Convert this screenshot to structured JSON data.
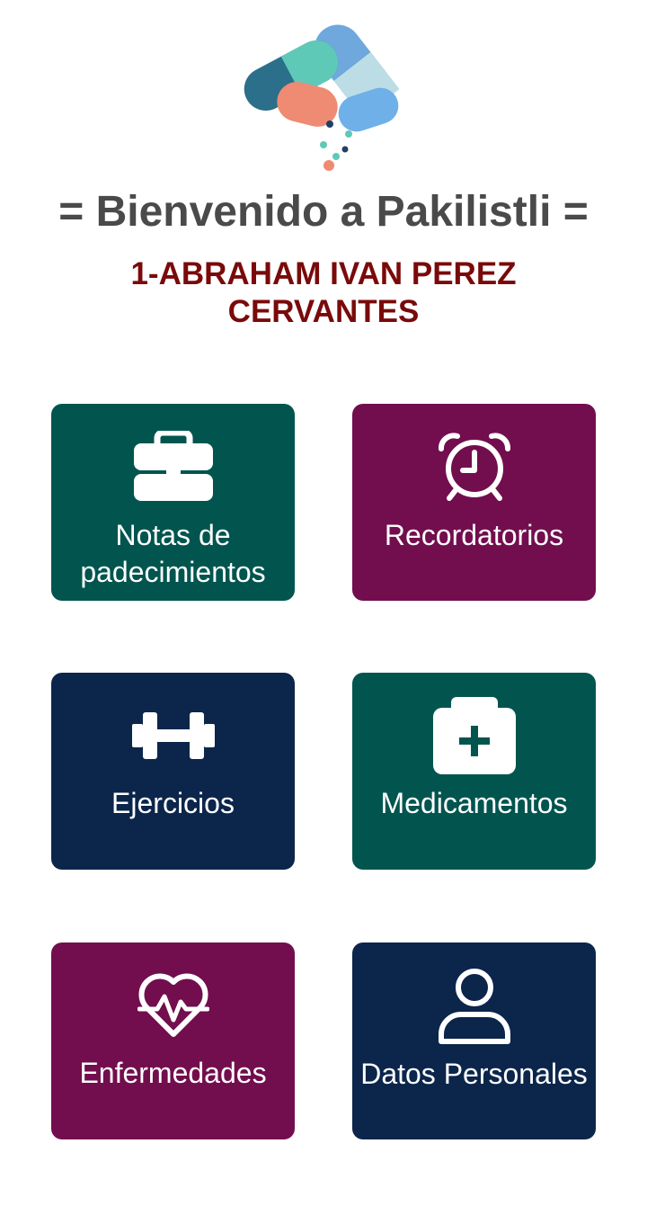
{
  "header": {
    "welcome_text": "= Bienvenido a Pakilistli =",
    "user_name": "1-ABRAHAM IVAN PEREZ CERVANTES"
  },
  "menu": {
    "items": [
      {
        "label": "Notas de padecimientos",
        "icon": "medical-kit-icon",
        "color": "#02554f"
      },
      {
        "label": "Recordatorios",
        "icon": "alarm-clock-icon",
        "color": "#720e4e"
      },
      {
        "label": "Ejercicios",
        "icon": "dumbbell-icon",
        "color": "#0c254b"
      },
      {
        "label": "Medicamentos",
        "icon": "first-aid-kit-icon",
        "color": "#02554f"
      },
      {
        "label": "Enfermedades",
        "icon": "heartbeat-icon",
        "color": "#720e4e"
      },
      {
        "label": "Datos Personales",
        "icon": "user-icon",
        "color": "#0c254b"
      }
    ]
  },
  "colors": {
    "welcome_text": "#4a4a4a",
    "user_name": "#7a0a0a",
    "background": "#ffffff"
  }
}
